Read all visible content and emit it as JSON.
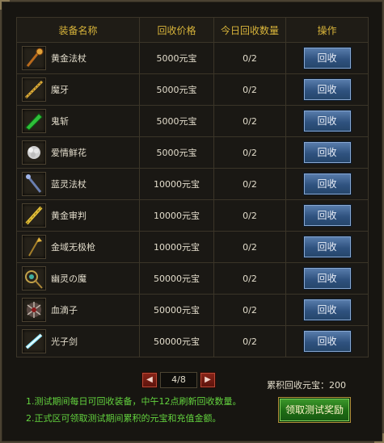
{
  "headers": [
    "装备名称",
    "回收价格",
    "今日回收数量",
    "操作"
  ],
  "rows": [
    {
      "name": "黄金法杖",
      "price": "5000元宝",
      "count": "0/2",
      "action": "回收",
      "icon": "golden-staff-icon"
    },
    {
      "name": "魔牙",
      "price": "5000元宝",
      "count": "0/2",
      "action": "回收",
      "icon": "demon-fang-icon"
    },
    {
      "name": "鬼斩",
      "price": "5000元宝",
      "count": "0/2",
      "action": "回收",
      "icon": "ghost-blade-icon"
    },
    {
      "name": "爱情鲜花",
      "price": "5000元宝",
      "count": "0/2",
      "action": "回收",
      "icon": "love-flower-icon"
    },
    {
      "name": "蓝灵法杖",
      "price": "10000元宝",
      "count": "0/2",
      "action": "回收",
      "icon": "blue-spirit-staff-icon"
    },
    {
      "name": "黄金审判",
      "price": "10000元宝",
      "count": "0/2",
      "action": "回收",
      "icon": "golden-judgment-icon"
    },
    {
      "name": "金域无极枪",
      "price": "10000元宝",
      "count": "0/2",
      "action": "回收",
      "icon": "golden-spear-icon"
    },
    {
      "name": "幽灵の魔",
      "price": "50000元宝",
      "count": "0/2",
      "action": "回收",
      "icon": "ghost-demon-icon"
    },
    {
      "name": "血滴子",
      "price": "50000元宝",
      "count": "0/2",
      "action": "回收",
      "icon": "blood-drop-icon"
    },
    {
      "name": "光子剑",
      "price": "50000元宝",
      "count": "0/2",
      "action": "回收",
      "icon": "photon-sword-icon"
    }
  ],
  "pager": {
    "label": "4/8",
    "prev_icon": "arrow-left-icon",
    "next_icon": "arrow-right-icon"
  },
  "total": "累积回收元宝：200",
  "notes": [
    "1.测试期间每日可回收装备，中午12点刷新回收数量。",
    "2.正式区可领取测试期间累积的元宝和充值金额。"
  ],
  "claim_button": "领取测试奖励",
  "colors": {
    "header_text": "#d8b43a",
    "note_text": "#63d33e",
    "button_blue": "#2f527f",
    "claim_green": "#1d6b14"
  }
}
